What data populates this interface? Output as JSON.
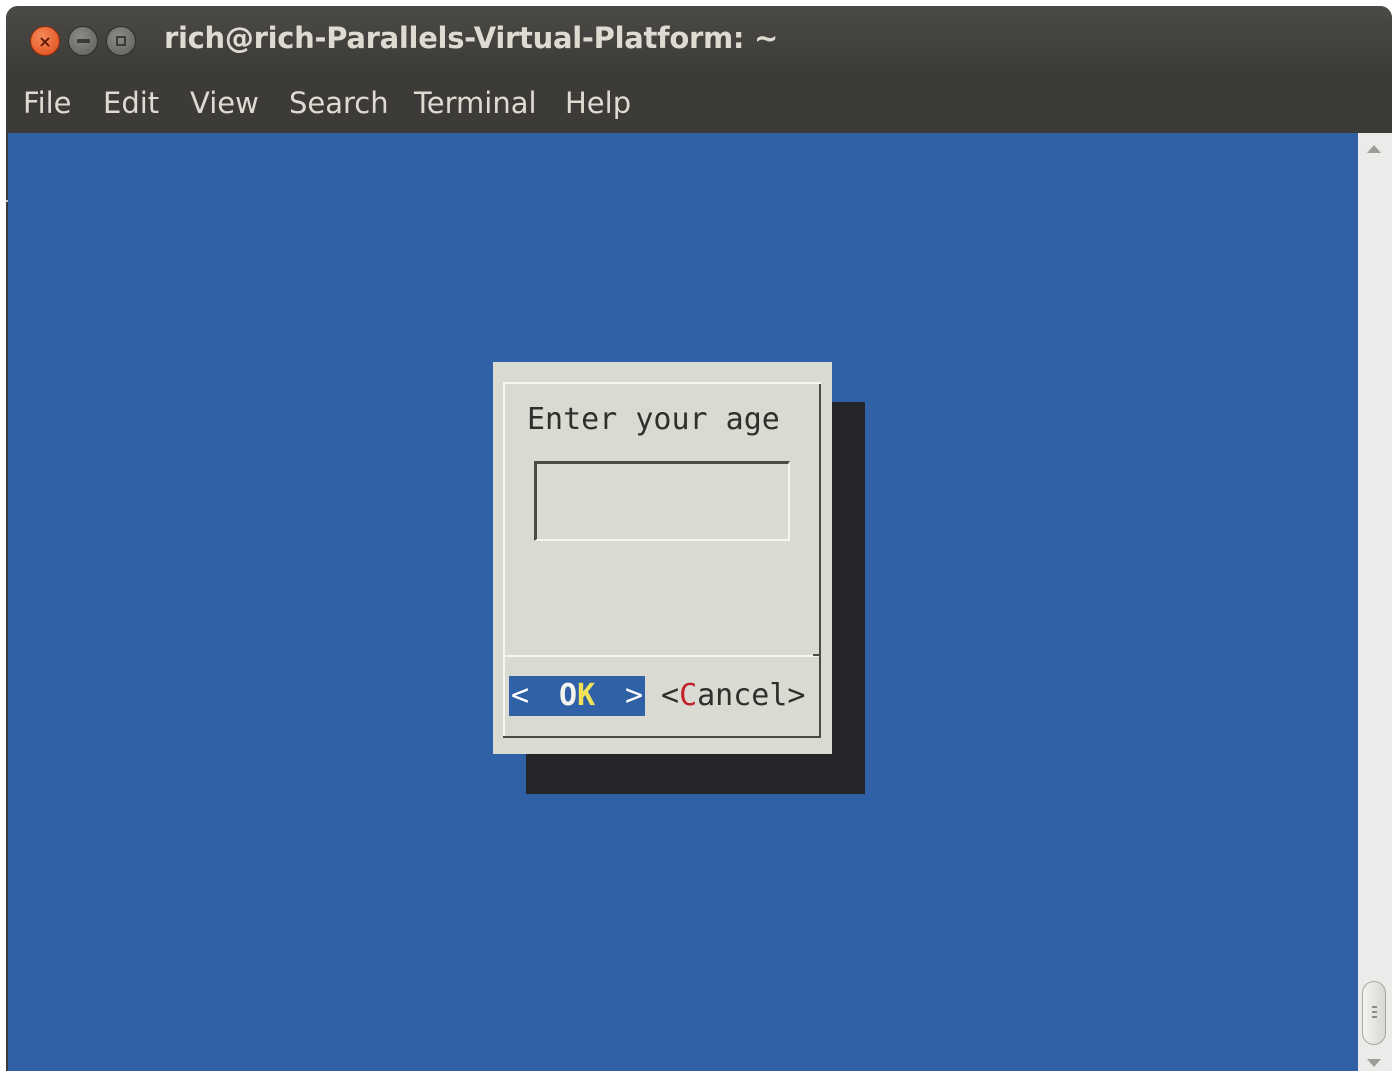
{
  "window": {
    "title": "rich@rich-Parallels-Virtual-Platform: ~",
    "close_glyph": "×"
  },
  "menubar": {
    "items": [
      {
        "label": "File"
      },
      {
        "label": "Edit"
      },
      {
        "label": "View"
      },
      {
        "label": "Search"
      },
      {
        "label": "Terminal"
      },
      {
        "label": "Help"
      }
    ]
  },
  "dialog": {
    "prompt": "Enter your age",
    "input_value": "",
    "ok_button": {
      "left_bracket": "<",
      "hotkey": "O",
      "rest": "K",
      "right_bracket": ">"
    },
    "cancel_button": {
      "prefix": "<",
      "hotkey": "C",
      "rest": "ancel>"
    }
  },
  "colors": {
    "terminal_background": "#3061a6",
    "dialog_background": "#d9dbd2",
    "dialog_shadow": "#242629",
    "title_bar": "#3c3b37",
    "title_text": "#dfdbd2",
    "selected_button": "#3061a6",
    "ok_hotkey": "#f0e35a",
    "cancel_hotkey": "#c3202a",
    "close_button": "#df4a16"
  },
  "icons": {
    "close": "close-icon",
    "minimize": "minimize-icon",
    "maximize": "maximize-icon",
    "scroll_up": "arrow-up-icon",
    "scroll_down": "arrow-down-icon"
  }
}
